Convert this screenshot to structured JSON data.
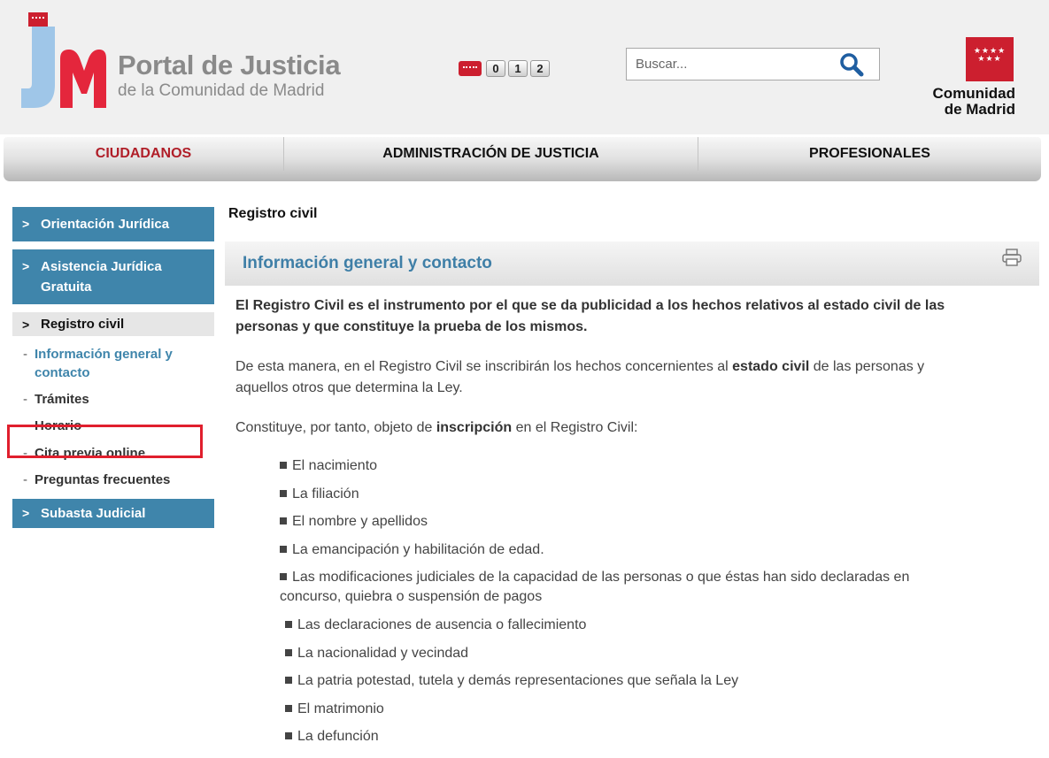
{
  "header": {
    "title": "Portal de Justicia",
    "subtitle": "de la Comunidad de Madrid",
    "phone_digits": [
      "0",
      "1",
      "2"
    ],
    "search": {
      "placeholder": "Buscar..."
    },
    "region_logo_lines": [
      "Comunidad",
      "de Madrid"
    ]
  },
  "nav": {
    "items": [
      {
        "label": "CIUDADANOS",
        "active": true
      },
      {
        "label": "ADMINISTRACIÓN DE JUSTICIA",
        "active": false
      },
      {
        "label": "PROFESIONALES",
        "active": false
      }
    ]
  },
  "sidebar": {
    "arrow": ">",
    "dash": "-",
    "items": [
      {
        "label": "Orientación Jurídica"
      },
      {
        "label": "Asistencia Jurídica Gratuita"
      },
      {
        "label": "Registro civil"
      },
      {
        "label": "Subasta Judicial"
      }
    ],
    "subitems": [
      {
        "label": "Información general y contacto",
        "current": true
      },
      {
        "label": "Trámites"
      },
      {
        "label": "Horario"
      },
      {
        "label": "Cita previa online",
        "highlighted": true
      },
      {
        "label": "Preguntas frecuentes"
      }
    ]
  },
  "content": {
    "page_title": "Registro civil",
    "section_title": "Información general y contacto",
    "intro": "El Registro Civil es el instrumento por el que se da publicidad a los hechos relativos al estado civil de las personas y que constituye la prueba de los mismos.",
    "para1": {
      "before": "De esta manera, en el Registro Civil se inscribirán los hechos concernientes al ",
      "bold": "estado civil",
      "after": " de las personas y aquellos otros que determina la Ley."
    },
    "para2": {
      "before": "Constituye, por tanto, objeto de ",
      "bold": "inscripción",
      "after": " en el Registro Civil:"
    },
    "bullets": [
      "El nacimiento",
      "La filiación",
      "El nombre y apellidos",
      "La emancipación y habilitación de edad.",
      "Las modificaciones judiciales de la capacidad de las personas o que éstas han sido declaradas en concurso, quiebra o suspensión de pagos",
      "Las declaraciones de ausencia o fallecimiento",
      "La nacionalidad y vecindad",
      "La patria potestad, tutela y demás representaciones que señala la Ley",
      "El matrimonio",
      "La defunción"
    ]
  },
  "colors": {
    "brand_red": "#cc1f2f",
    "sidebar_blue": "#3f85ab",
    "active_nav": "#b01e28",
    "highlight_box": "#e01f2d"
  },
  "icons": {
    "search": "search-icon",
    "print": "print-icon"
  }
}
